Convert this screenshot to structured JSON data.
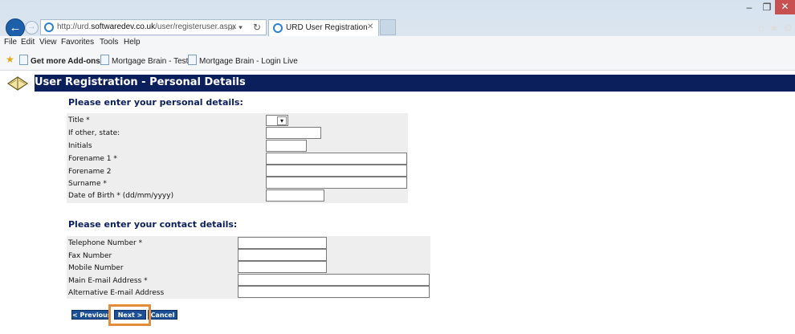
{
  "browser": {
    "url_prefix": "http://urd.",
    "url_domain": "softwaredev.co.uk",
    "url_path": "/user/registeruser.aspx",
    "tab_title": "URD User Registration",
    "menu": [
      "File",
      "Edit",
      "View",
      "Favorites",
      "Tools",
      "Help"
    ],
    "favorites": [
      "Get more Add-ons ▾",
      "Mortgage Brain - Test",
      "Mortgage Brain - Login Live"
    ]
  },
  "page": {
    "title": "User Registration - Personal Details",
    "personal_heading": "Please enter your personal details:",
    "contact_heading": "Please enter your contact details:"
  },
  "personal_fields": [
    {
      "label": "Title *",
      "value": ""
    },
    {
      "label": "If other, state:",
      "value": ""
    },
    {
      "label": "Initials",
      "value": ""
    },
    {
      "label": "Forename 1 *",
      "value": ""
    },
    {
      "label": "Forename 2",
      "value": ""
    },
    {
      "label": "Surname *",
      "value": ""
    },
    {
      "label": "Date of Birth * (dd/mm/yyyy)",
      "value": ""
    }
  ],
  "contact_fields": [
    {
      "label": "Telephone Number *",
      "value": ""
    },
    {
      "label": "Fax Number",
      "value": ""
    },
    {
      "label": "Mobile Number",
      "value": ""
    },
    {
      "label": "Main E-mail Address *",
      "value": ""
    },
    {
      "label": "Alternative E-mail Address",
      "value": ""
    }
  ],
  "buttons": {
    "previous": "< Previous",
    "next": "Next >",
    "cancel": "Cancel"
  },
  "colors": {
    "header_bg": "#0b1f5c",
    "button_bg": "#1c4f96",
    "highlight": "#e58b3c"
  }
}
